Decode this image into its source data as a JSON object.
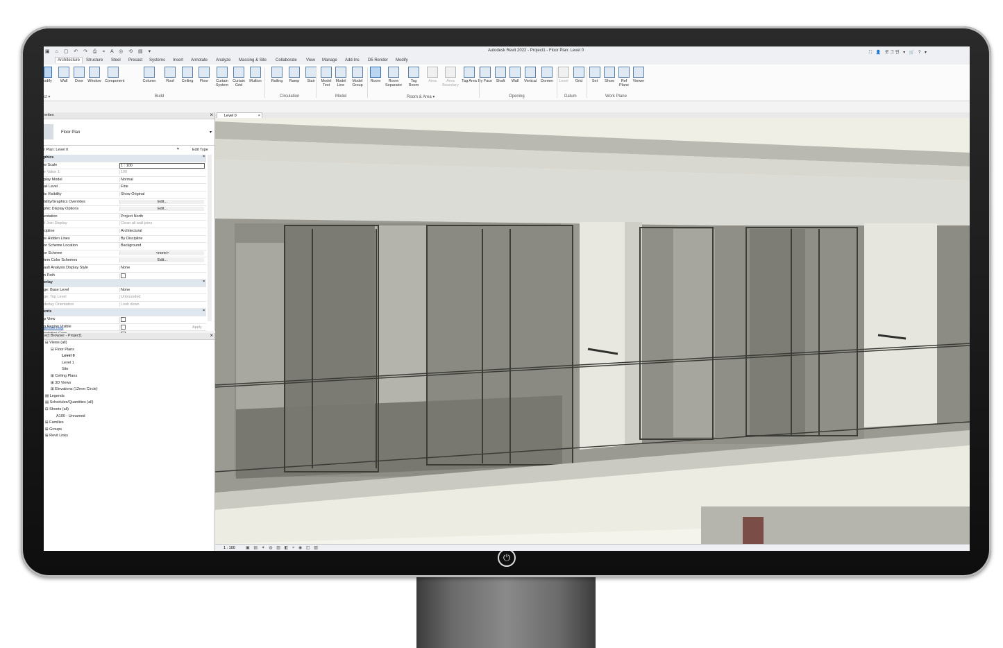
{
  "app": {
    "title": "Autodesk Revit 2022 - Project1 - Floor Plan: Level 0",
    "qat_icons": "▣ ⌂ ▢ ↶ ↷ ⎙ ⌖ A ◎ ⟲ ▤ ▾",
    "title_right": "⛶ 👤 로그인 ▾ 🛒 ? ▾"
  },
  "tabs": [
    "Architecture",
    "Structure",
    "Steel",
    "Precast",
    "Systems",
    "Insert",
    "Annotate",
    "Analyze",
    "Massing & Site",
    "Collaborate",
    "View",
    "Manage",
    "Add-Ins",
    "D5 Render",
    "Modify"
  ],
  "ribbon": {
    "modify_label": "odify",
    "select_label": "ct ▾",
    "buttons": [
      {
        "label": "Wall"
      },
      {
        "label": "Door"
      },
      {
        "label": "Window"
      },
      {
        "label": "Component"
      },
      {
        "label": "Column"
      },
      {
        "label": "Roof"
      },
      {
        "label": "Ceiling"
      },
      {
        "label": "Floor"
      },
      {
        "label": "Curtain System"
      },
      {
        "label": "Curtain Grid"
      },
      {
        "label": "Mullion"
      },
      {
        "label": "Railing"
      },
      {
        "label": "Ramp"
      },
      {
        "label": "Stair"
      },
      {
        "label": "Model Text"
      },
      {
        "label": "Model Line"
      },
      {
        "label": "Model Group"
      },
      {
        "label": "Room"
      },
      {
        "label": "Room Separator"
      },
      {
        "label": "Tag Room"
      },
      {
        "label": "Area"
      },
      {
        "label": "Area Boundary"
      },
      {
        "label": "Tag Area"
      },
      {
        "label": "By Face"
      },
      {
        "label": "Shaft"
      },
      {
        "label": "Wall"
      },
      {
        "label": "Vertical"
      },
      {
        "label": "Dormer"
      },
      {
        "label": "Level"
      },
      {
        "label": "Grid"
      },
      {
        "label": "Set"
      },
      {
        "label": "Show"
      },
      {
        "label": "Ref Plane"
      },
      {
        "label": "Viewer"
      }
    ],
    "groups": {
      "build": "Build",
      "circulation": "Circulation",
      "model": "Model",
      "room_area": "Room & Area ▾",
      "opening": "Opening",
      "datum": "Datum",
      "work_plane": "Work Plane"
    }
  },
  "properties": {
    "header": "erties",
    "type_name": "Floor Plan",
    "instance_label": "r Plan: Level 0",
    "edit_type": "Edit Type",
    "rows": [
      {
        "k": "phics",
        "v": "",
        "sect": true
      },
      {
        "k": "w Scale",
        "v": "1 : 100",
        "style": "box"
      },
      {
        "k": "e Value    1:",
        "v": "100",
        "grey": true
      },
      {
        "k": "play Model",
        "v": "Normal"
      },
      {
        "k": "ail Level",
        "v": "Fine"
      },
      {
        "k": "ts Visibility",
        "v": "Show Original"
      },
      {
        "k": "bility/Graphics Overrides",
        "v": "Edit...",
        "style": "btn"
      },
      {
        "k": "phic Display Options",
        "v": "Edit...",
        "style": "btn"
      },
      {
        "k": "entation",
        "v": "Project North"
      },
      {
        "k": "ll Join Display",
        "v": "Clean all wall joins",
        "grey": true
      },
      {
        "k": "cipline",
        "v": "Architectural"
      },
      {
        "k": "w Hidden Lines",
        "v": "By Discipline"
      },
      {
        "k": "or Scheme Location",
        "v": "Background"
      },
      {
        "k": "or Scheme",
        "v": "<none>",
        "style": "btn"
      },
      {
        "k": "tem Color Schemes",
        "v": "Edit...",
        "style": "btn"
      },
      {
        "k": "ault Analysis Display Style",
        "v": "None"
      },
      {
        "k": "n Path",
        "v": "",
        "check": true
      },
      {
        "k": "erlay",
        "v": "",
        "sect": true
      },
      {
        "k": "ge: Base Level",
        "v": "None"
      },
      {
        "k": "ge: Top Level",
        "v": "Unbounded",
        "grey": true
      },
      {
        "k": "derlay Orientation",
        "v": "Look down",
        "grey": true
      },
      {
        "k": "ents",
        "v": "",
        "sect": true
      },
      {
        "k": "p View",
        "v": "",
        "check": true
      },
      {
        "k": "p Region Visible",
        "v": "",
        "check": true
      },
      {
        "k": "notation Crop",
        "v": "",
        "check": true
      }
    ],
    "help": "perties help",
    "apply": "Apply"
  },
  "browser": {
    "header": "ect Browser - Project1",
    "items": [
      {
        "label": "Views (all)",
        "indent": 0,
        "prefix": "⊟ "
      },
      {
        "label": "Floor Plans",
        "indent": 1,
        "prefix": "⊟ "
      },
      {
        "label": "Level 0",
        "indent": 3,
        "prefix": "",
        "bold": true
      },
      {
        "label": "Level 1",
        "indent": 3,
        "prefix": ""
      },
      {
        "label": "Site",
        "indent": 3,
        "prefix": ""
      },
      {
        "label": "Ceiling Plans",
        "indent": 1,
        "prefix": "⊞ "
      },
      {
        "label": "3D Views",
        "indent": 1,
        "prefix": "⊞ "
      },
      {
        "label": "Elevations (12mm Circle)",
        "indent": 1,
        "prefix": "⊞ "
      },
      {
        "label": "Legends",
        "indent": 0,
        "prefix": "▤ "
      },
      {
        "label": "Schedules/Quantities (all)",
        "indent": 0,
        "prefix": "▤ "
      },
      {
        "label": "Sheets (all)",
        "indent": 0,
        "prefix": "⊟ "
      },
      {
        "label": "A100 - Unnamed",
        "indent": 2,
        "prefix": ""
      },
      {
        "label": "Families",
        "indent": 0,
        "prefix": "⊞ "
      },
      {
        "label": "Groups",
        "indent": 0,
        "prefix": "⊞ "
      },
      {
        "label": "Revit Links",
        "indent": 0,
        "prefix": "⊞ "
      }
    ]
  },
  "viewport": {
    "tab": "Level 0",
    "scale": "1 : 100",
    "status_icons": "▣ ▤ ✦ ◍ ▥ ◧ ⌖ ◉ ◫ ▧"
  },
  "colors": {
    "accent": "#2f6eb5",
    "ribbon_bg": "#fbfbfb",
    "viewport_bg": "#f4f4ec",
    "bezel": "#111111"
  }
}
